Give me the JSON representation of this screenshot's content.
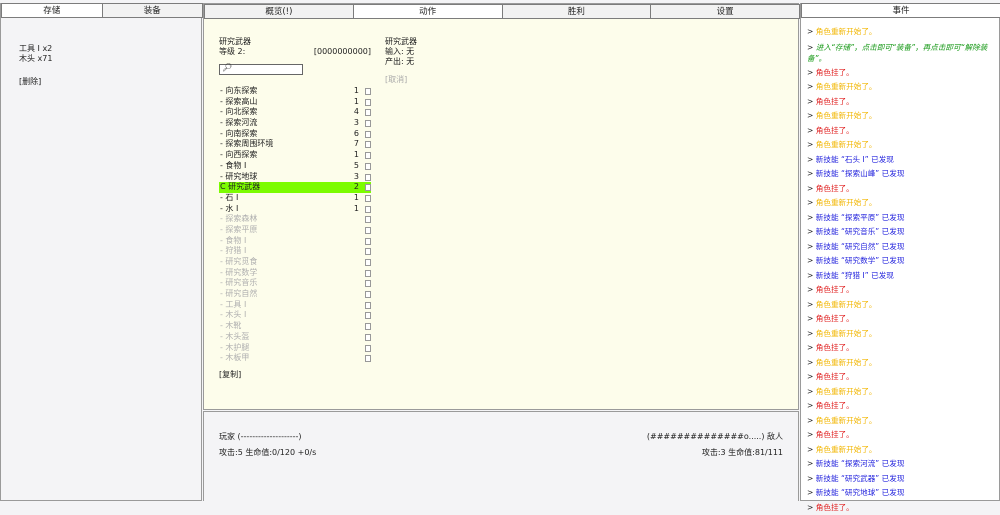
{
  "left": {
    "tabs": [
      "存储",
      "装备"
    ],
    "items": [
      "工具 I x2",
      "木头 x71"
    ],
    "delete_label": "[删除]"
  },
  "action": {
    "tabs": [
      "概览(!)",
      "动作",
      "胜利",
      "设置"
    ],
    "selected_title": "研究武器",
    "level_label": "等级 2:",
    "progress": "[0000000000]",
    "search_icon": "magnifier-icon",
    "list": [
      {
        "name": "- 向东探索",
        "count": "1",
        "state": "normal"
      },
      {
        "name": "- 探索高山",
        "count": "1",
        "state": "normal"
      },
      {
        "name": "- 向北探索",
        "count": "4",
        "state": "normal"
      },
      {
        "name": "- 探索河流",
        "count": "3",
        "state": "normal"
      },
      {
        "name": "- 向南探索",
        "count": "6",
        "state": "normal"
      },
      {
        "name": "- 探索周围环境",
        "count": "7",
        "state": "normal"
      },
      {
        "name": "- 向西探索",
        "count": "1",
        "state": "normal"
      },
      {
        "name": "- 食物 I",
        "count": "5",
        "state": "normal"
      },
      {
        "name": "- 研究地球",
        "count": "3",
        "state": "normal"
      },
      {
        "name": "C 研究武器",
        "count": "2",
        "state": "selected"
      },
      {
        "name": "- 石 I",
        "count": "1",
        "state": "normal"
      },
      {
        "name": "- 水 I",
        "count": "1",
        "state": "normal"
      },
      {
        "name": "- 探索森林",
        "count": "",
        "state": "dim"
      },
      {
        "name": "- 探索平原",
        "count": "",
        "state": "dim"
      },
      {
        "name": "- 食物 I",
        "count": "",
        "state": "dim"
      },
      {
        "name": "- 狩猎 I",
        "count": "",
        "state": "dim"
      },
      {
        "name": "- 研究觅食",
        "count": "",
        "state": "dim"
      },
      {
        "name": "- 研究数学",
        "count": "",
        "state": "dim"
      },
      {
        "name": "- 研究音乐",
        "count": "",
        "state": "dim"
      },
      {
        "name": "- 研究自然",
        "count": "",
        "state": "dim"
      },
      {
        "name": "- 工具 I",
        "count": "",
        "state": "dim"
      },
      {
        "name": "- 木头 I",
        "count": "",
        "state": "dim"
      },
      {
        "name": "- 木靴",
        "count": "",
        "state": "dim"
      },
      {
        "name": "- 木头盔",
        "count": "",
        "state": "dim"
      },
      {
        "name": "- 木护腿",
        "count": "",
        "state": "dim"
      },
      {
        "name": "- 木板甲",
        "count": "",
        "state": "dim"
      }
    ],
    "copy_label": "[复制]",
    "detail": {
      "title": "研究武器",
      "input": "输入: 无",
      "output": "产出: 无",
      "cancel": "[取消]"
    }
  },
  "battle": {
    "player": "玩家 (--------------------)",
    "player_stats": "攻击:5 生命值:0/120 +0/s",
    "enemy": "(##############o.....) 敌人",
    "enemy_stats": "攻击:3 生命值:81/111"
  },
  "events": {
    "tab": "事件",
    "entries": [
      {
        "text": "角色重新开始了。",
        "type": "yellow"
      },
      {
        "text": "进入“存储”，点击即可“装备”，再点击即可“解除装备”。",
        "type": "green"
      },
      {
        "text": "角色挂了。",
        "type": "red"
      },
      {
        "text": "角色重新开始了。",
        "type": "yellow"
      },
      {
        "text": "角色挂了。",
        "type": "red"
      },
      {
        "text": "角色重新开始了。",
        "type": "yellow"
      },
      {
        "text": "角色挂了。",
        "type": "red"
      },
      {
        "text": "角色重新开始了。",
        "type": "yellow"
      },
      {
        "text": "新技能 “石头 I” 已发现",
        "type": "blue"
      },
      {
        "text": "新技能 “探索山峰” 已发现",
        "type": "blue"
      },
      {
        "text": "角色挂了。",
        "type": "red"
      },
      {
        "text": "角色重新开始了。",
        "type": "yellow"
      },
      {
        "text": "新技能 “探索平原” 已发现",
        "type": "blue"
      },
      {
        "text": "新技能 “研究音乐” 已发现",
        "type": "blue"
      },
      {
        "text": "新技能 “研究自然” 已发现",
        "type": "blue"
      },
      {
        "text": "新技能 “研究数学” 已发现",
        "type": "blue"
      },
      {
        "text": "新技能 “狩猎 I” 已发现",
        "type": "blue"
      },
      {
        "text": "角色挂了。",
        "type": "red"
      },
      {
        "text": "角色重新开始了。",
        "type": "yellow"
      },
      {
        "text": "角色挂了。",
        "type": "red"
      },
      {
        "text": "角色重新开始了。",
        "type": "yellow"
      },
      {
        "text": "角色挂了。",
        "type": "red"
      },
      {
        "text": "角色重新开始了。",
        "type": "yellow"
      },
      {
        "text": "角色挂了。",
        "type": "red"
      },
      {
        "text": "角色重新开始了。",
        "type": "yellow"
      },
      {
        "text": "角色挂了。",
        "type": "red"
      },
      {
        "text": "角色重新开始了。",
        "type": "yellow"
      },
      {
        "text": "角色挂了。",
        "type": "red"
      },
      {
        "text": "角色重新开始了。",
        "type": "yellow"
      },
      {
        "text": "新技能 “探索河流” 已发现",
        "type": "blue"
      },
      {
        "text": "新技能 “研究武器” 已发现",
        "type": "blue"
      },
      {
        "text": "新技能 “研究地球” 已发现",
        "type": "blue"
      },
      {
        "text": "角色挂了。",
        "type": "red"
      }
    ]
  }
}
